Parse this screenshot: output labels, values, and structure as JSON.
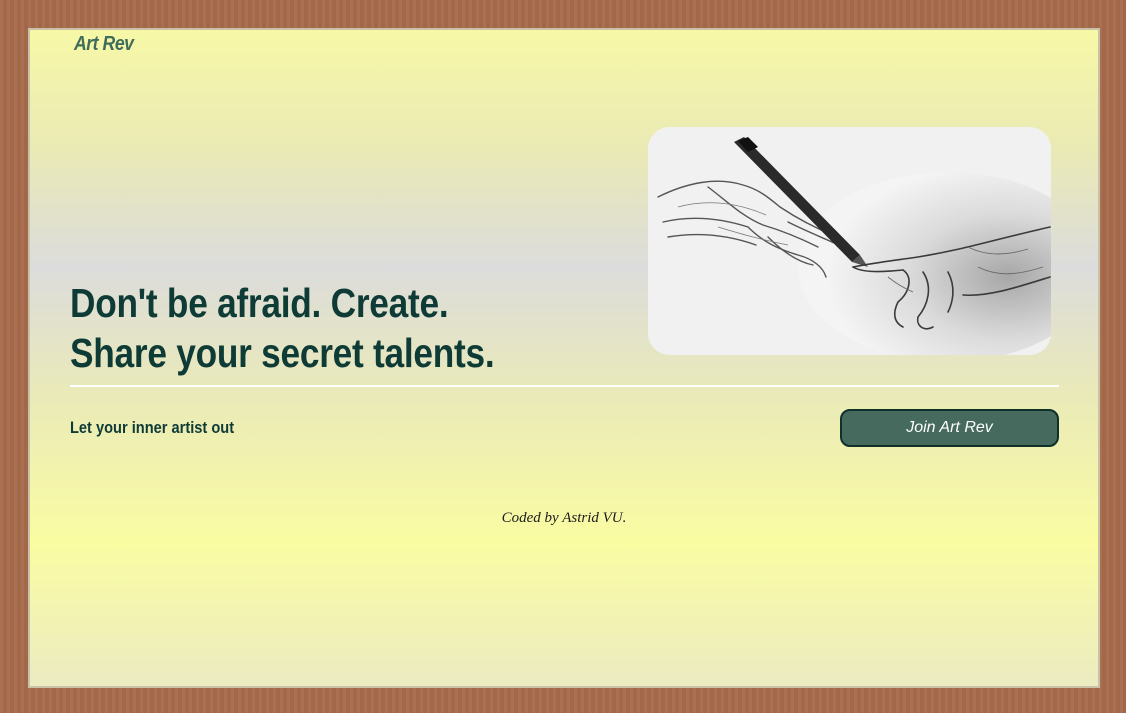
{
  "header": {
    "logo_text": "Art Rev"
  },
  "hero": {
    "headline_line1": "Don't be afraid. Create.",
    "headline_line2": "Share your secret talents.",
    "image_subject": "pencil-drawing-of-hands"
  },
  "cta": {
    "tagline": "Let your inner artist out",
    "button_label": "Join Art Rev"
  },
  "footer": {
    "credit": "Coded by Astrid VU."
  },
  "colors": {
    "frame": "#a86b4c",
    "heading": "#0e3b36",
    "logo": "#3f6d5b",
    "button_bg": "#466b5e",
    "button_text": "#ffffff"
  }
}
